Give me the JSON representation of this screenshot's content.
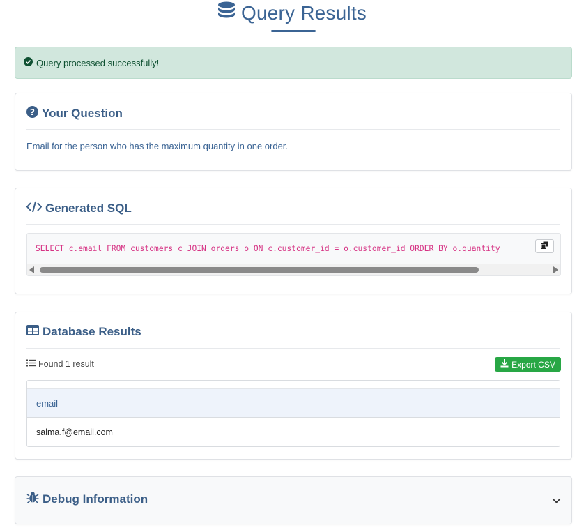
{
  "header": {
    "title": "Query Results",
    "icon": "database-icon"
  },
  "alert": {
    "message": "Query processed successfully!",
    "icon": "check-circle-icon",
    "color": "#0f5132"
  },
  "question": {
    "title": "Your Question",
    "icon": "question-circle-icon",
    "text": "Email for the person who has the maximum quantity in one order."
  },
  "sql": {
    "title": "Generated SQL",
    "icon": "code-icon",
    "query": "SELECT c.email FROM customers c JOIN orders o ON c.customer_id = o.customer_id ORDER BY o.quantity",
    "copy_icon": "copy-icon"
  },
  "results": {
    "title": "Database Results",
    "icon": "table-icon",
    "count_text": "Found 1 result",
    "export_label": "Export CSV",
    "columns": [
      "email"
    ],
    "rows": [
      [
        "salma.f@email.com"
      ]
    ]
  },
  "debug": {
    "title": "Debug Information",
    "icon": "bug-icon"
  },
  "colors": {
    "accent": "#3b6494",
    "success": "#28a745",
    "sql": "#d63384"
  }
}
